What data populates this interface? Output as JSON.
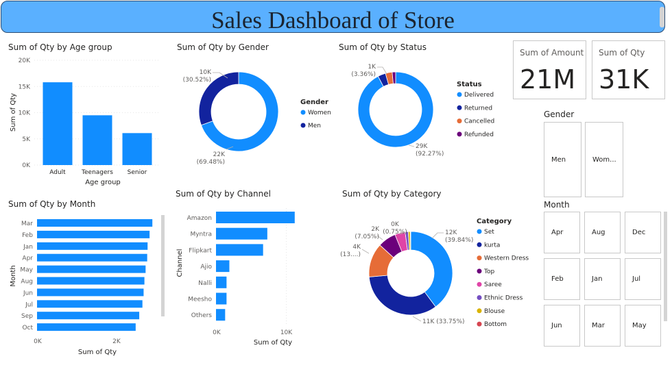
{
  "header": {
    "title": "Sales Dashboard of Store"
  },
  "colors": {
    "blue": "#118dff",
    "navy": "#12239e",
    "orange": "#e66c37",
    "purple": "#6b007b",
    "pink": "#e044a7",
    "violet": "#744ec2",
    "yellow": "#d9b300",
    "red": "#d64550"
  },
  "cards": {
    "amount": {
      "label": "Sum of Amount",
      "value": "21M"
    },
    "qty": {
      "label": "Sum of Qty",
      "value": "31K"
    }
  },
  "slicers": {
    "gender": {
      "title": "Gender",
      "items": [
        "Men",
        "Wom..."
      ]
    },
    "month": {
      "title": "Month",
      "items": [
        "Apr",
        "Aug",
        "Dec",
        "Feb",
        "Jan",
        "Jul",
        "Jun",
        "Mar",
        "May"
      ]
    }
  },
  "chart_data": [
    {
      "id": "age",
      "type": "bar",
      "title": "Sum of Qty by Age group",
      "xlabel": "Age group",
      "ylabel": "Sum of Qty",
      "categories": [
        "Adult",
        "Teenagers",
        "Senior"
      ],
      "values": [
        15800,
        9500,
        6100
      ],
      "ylim": [
        0,
        20000
      ],
      "yticks": [
        "0K",
        "5K",
        "10K",
        "15K",
        "20K"
      ],
      "grid": true
    },
    {
      "id": "gender",
      "type": "pie",
      "donut": true,
      "title": "Sum of Qty by Gender",
      "legend_title": "Gender",
      "legend_position": "right",
      "categories": [
        "Women",
        "Men"
      ],
      "values": [
        69.48,
        30.52
      ],
      "labels": [
        [
          "22K",
          "(69.48%)"
        ],
        [
          "10K",
          "(30.52%)"
        ]
      ]
    },
    {
      "id": "status",
      "type": "pie",
      "donut": true,
      "title": "Sum of Qty by Status",
      "legend_title": "Status",
      "legend_position": "right",
      "categories": [
        "Delivered",
        "Returned",
        "Cancelled",
        "Refunded"
      ],
      "values": [
        92.27,
        3.36,
        2.9,
        1.47
      ],
      "labels": [
        [
          "29K",
          "(92.27%)"
        ],
        [
          "1K",
          "(3.36%)"
        ],
        [
          "",
          ""
        ],
        [
          "",
          ""
        ]
      ]
    },
    {
      "id": "month",
      "type": "bar",
      "orientation": "horizontal",
      "title": "Sum of Qty by Month",
      "xlabel": "Sum of Qty",
      "ylabel": "Month",
      "categories": [
        "Mar",
        "Feb",
        "Jan",
        "Apr",
        "May",
        "Aug",
        "Jun",
        "Jul",
        "Sep",
        "Oct"
      ],
      "values": [
        2900,
        2830,
        2780,
        2770,
        2730,
        2700,
        2680,
        2650,
        2570,
        2480
      ],
      "xlim": [
        0,
        3000
      ],
      "xticks": [
        "0K",
        "2K"
      ]
    },
    {
      "id": "channel",
      "type": "bar",
      "orientation": "horizontal",
      "title": "Sum of Qty by Channel",
      "xlabel": "Sum of Qty",
      "ylabel": "Channel",
      "categories": [
        "Amazon",
        "Myntra",
        "Flipkart",
        "Ajio",
        "Nalli",
        "Meesho",
        "Others"
      ],
      "values": [
        11200,
        7300,
        6700,
        1900,
        1500,
        1500,
        1300
      ],
      "xlim": [
        0,
        12000
      ],
      "xticks": [
        "0K",
        "10K"
      ]
    },
    {
      "id": "category",
      "type": "pie",
      "donut": true,
      "title": "Sum of Qty by Category",
      "legend_title": "Category",
      "legend_position": "right",
      "categories": [
        "Set",
        "kurta",
        "Western Dress",
        "Top",
        "Saree",
        "Ethnic Dress",
        "Blouse",
        "Bottom"
      ],
      "values": [
        39.84,
        33.75,
        13.2,
        7.05,
        4.0,
        1.2,
        0.75,
        0.21
      ],
      "labels": [
        [
          "12K",
          "(39.84%)"
        ],
        [
          "11K (33.75%)",
          ""
        ],
        [
          "4K",
          "(13....)"
        ],
        [
          "2K",
          "(7.05%)"
        ],
        [
          "",
          ""
        ],
        [
          "",
          ""
        ],
        [
          "0K",
          "(0.75%)"
        ],
        [
          "",
          ""
        ]
      ]
    }
  ]
}
